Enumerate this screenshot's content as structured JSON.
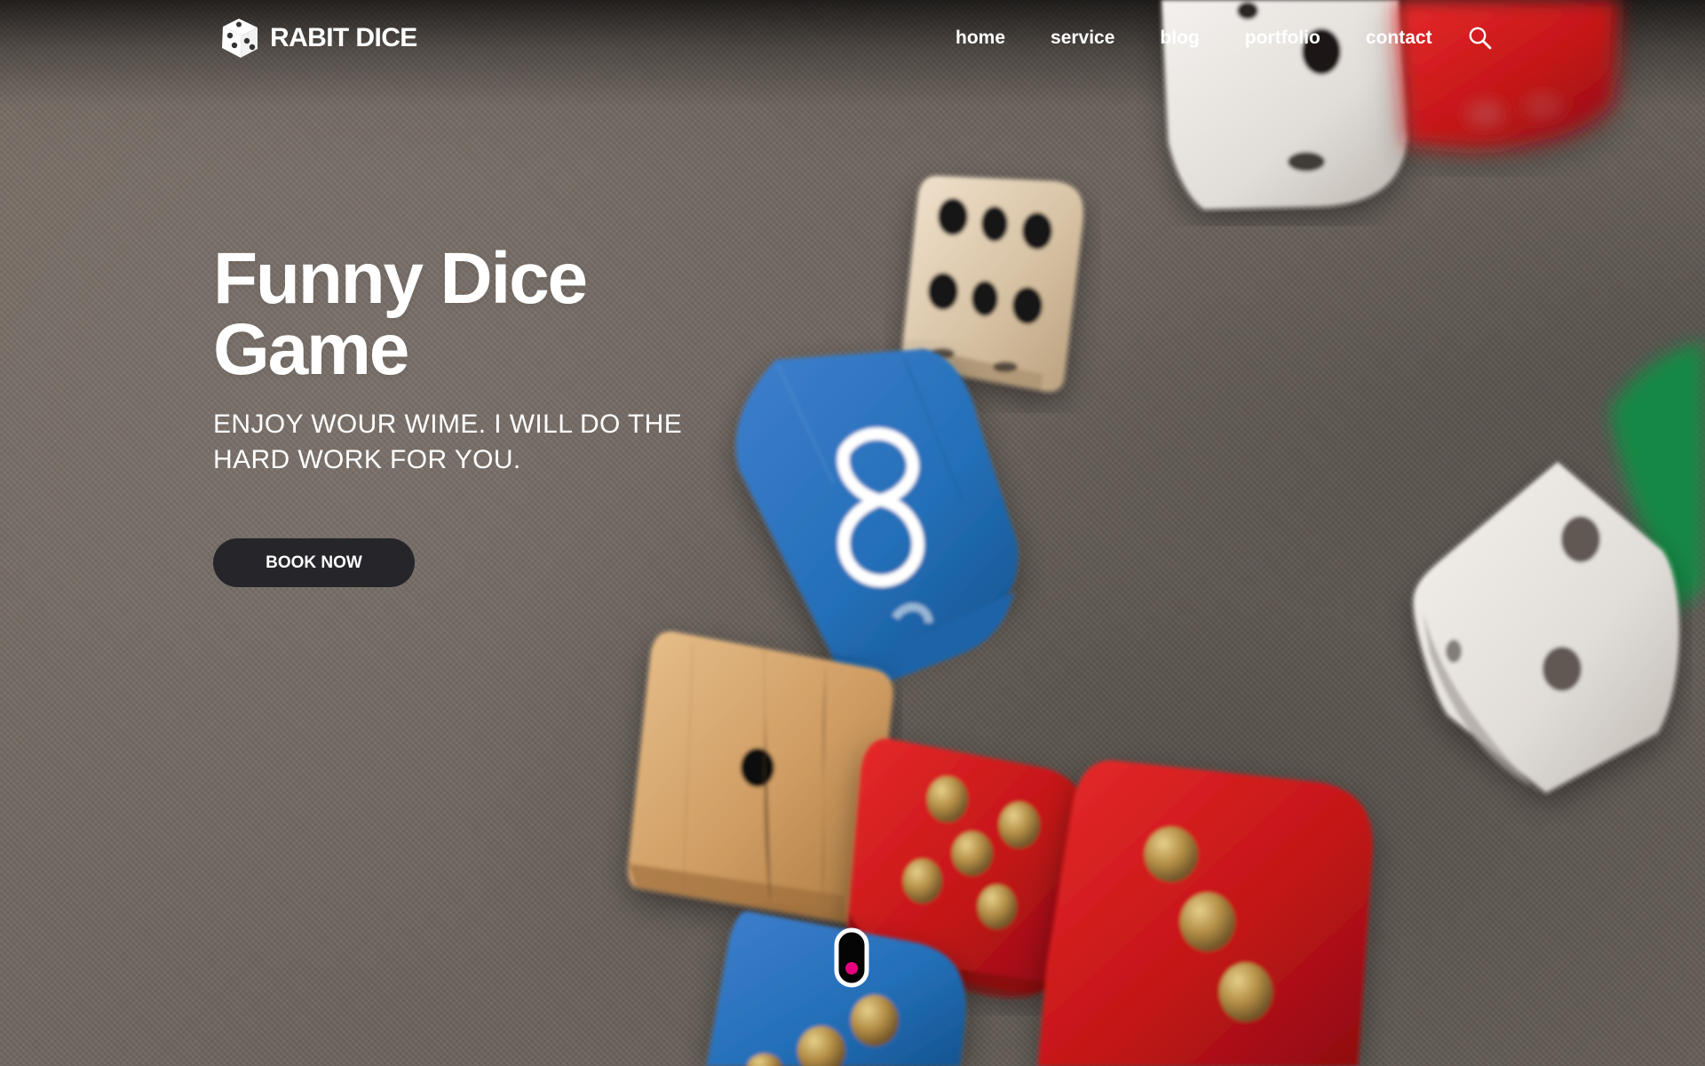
{
  "brand": {
    "name": "RABIT DICE",
    "logo_icon": "dice-logo-icon"
  },
  "nav": {
    "links": [
      {
        "label": "home"
      },
      {
        "label": "service"
      },
      {
        "label": "blog"
      },
      {
        "label": "portfolio"
      },
      {
        "label": "contact"
      }
    ],
    "search_icon": "search-icon"
  },
  "hero": {
    "title": "Funny Dice Game",
    "subtitle": "ENJOY WOUR WIME. I WILL DO THE HARD WORK FOR YOU.",
    "button": "BOOK NOW"
  },
  "colors": {
    "button_bg": "#25252a",
    "text": "#ffffff",
    "scroll_dot": "#e6007e",
    "background": "#6f665f"
  },
  "scroll_indicator": {
    "icon": "scroll-indicator-icon"
  },
  "photo": {
    "icon": "dice-photo"
  }
}
